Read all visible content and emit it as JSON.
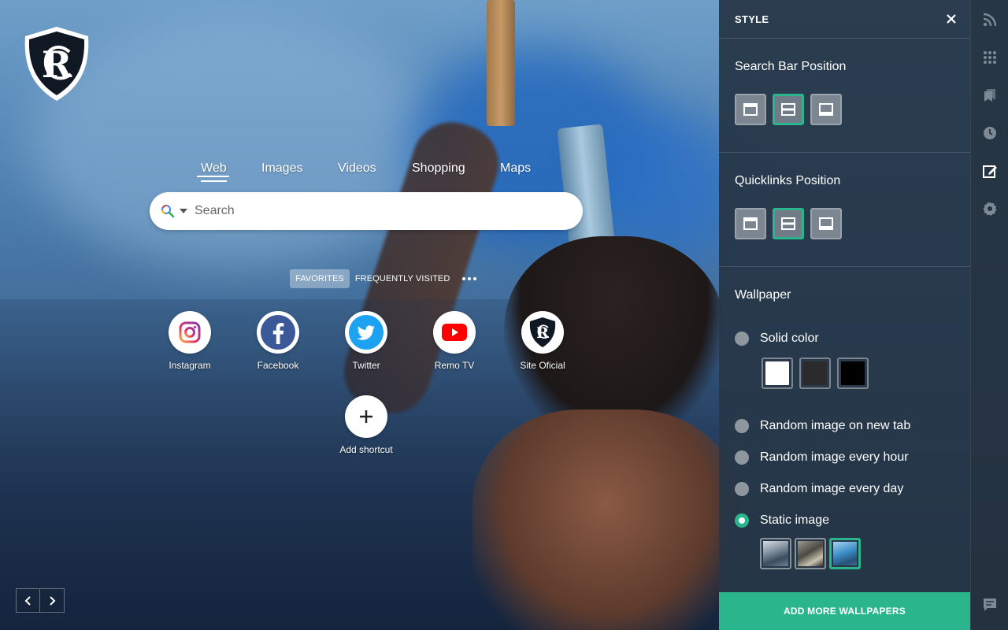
{
  "search": {
    "tabs": [
      "Web",
      "Images",
      "Videos",
      "Shopping",
      "Maps"
    ],
    "active_tab": "Web",
    "placeholder": "Search"
  },
  "quicklinks": {
    "tabs": [
      "FAVORITES",
      "FREQUENTLY VISITED"
    ],
    "active_tab": "FAVORITES",
    "items": [
      {
        "label": "Instagram",
        "icon": "instagram-icon"
      },
      {
        "label": "Facebook",
        "icon": "facebook-icon"
      },
      {
        "label": "Twitter",
        "icon": "twitter-icon"
      },
      {
        "label": "Remo TV",
        "icon": "youtube-icon"
      },
      {
        "label": "Site Oficial",
        "icon": "club-crest-icon"
      }
    ],
    "add_label": "Add shortcut"
  },
  "panel": {
    "title": "STYLE",
    "search_bar_title": "Search Bar Position",
    "quicklinks_title": "Quicklinks Position",
    "wallpaper_title": "Wallpaper",
    "options": {
      "solid": "Solid color",
      "random_tab": "Random image on new tab",
      "random_hour": "Random image every hour",
      "random_day": "Random image every day",
      "static": "Static image"
    },
    "selected_option": "Static image",
    "swatch_colors": [
      "#ffffff",
      "#2b2b2b",
      "#000000"
    ],
    "add_more_label": "ADD MORE WALLPAPERS"
  },
  "colors": {
    "accent": "#2bb58d",
    "panel_bg": "#263646"
  }
}
